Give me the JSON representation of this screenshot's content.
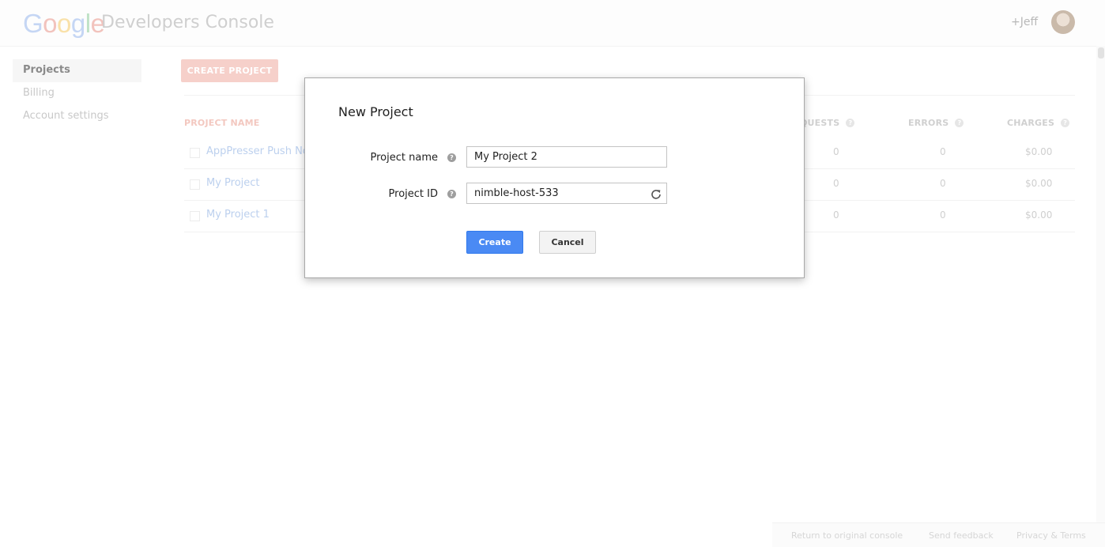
{
  "header": {
    "logo_letters": [
      {
        "ch": "G",
        "color": "#c5d6f4"
      },
      {
        "ch": "o",
        "color": "#f2c3bd"
      },
      {
        "ch": "o",
        "color": "#f9e1a9"
      },
      {
        "ch": "g",
        "color": "#c5d6f4"
      },
      {
        "ch": "l",
        "color": "#bfe2c6"
      },
      {
        "ch": "e",
        "color": "#f2c3bd"
      }
    ],
    "title": "Developers Console",
    "user_link": "+Jeff"
  },
  "sidebar": {
    "items": [
      {
        "label": "Projects",
        "active": true
      },
      {
        "label": "Billing",
        "active": false
      },
      {
        "label": "Account settings",
        "active": false
      }
    ]
  },
  "main": {
    "create_button": "CREATE PROJECT",
    "columns": {
      "name": "PROJECT NAME",
      "requests": "QUESTS",
      "errors": "ERRORS",
      "charges": "CHARGES"
    },
    "rows": [
      {
        "name": "AppPresser Push No",
        "requests": "0",
        "errors": "0",
        "charges": "$0.00"
      },
      {
        "name": "My Project",
        "requests": "0",
        "errors": "0",
        "charges": "$0.00"
      },
      {
        "name": "My Project 1",
        "requests": "0",
        "errors": "0",
        "charges": "$0.00"
      }
    ]
  },
  "dialog": {
    "title": "New Project",
    "project_name_label": "Project name",
    "project_name_value": "My Project 2",
    "project_id_label": "Project ID",
    "project_id_value": "nimble-host-533",
    "create_label": "Create",
    "cancel_label": "Cancel",
    "help_glyph": "?"
  },
  "footer": {
    "links": [
      "Return to original console",
      "Send feedback",
      "Privacy & Terms"
    ]
  },
  "colors": {
    "accent_blue": "#4a8af4",
    "create_project_faded": "#f6d0ca"
  }
}
